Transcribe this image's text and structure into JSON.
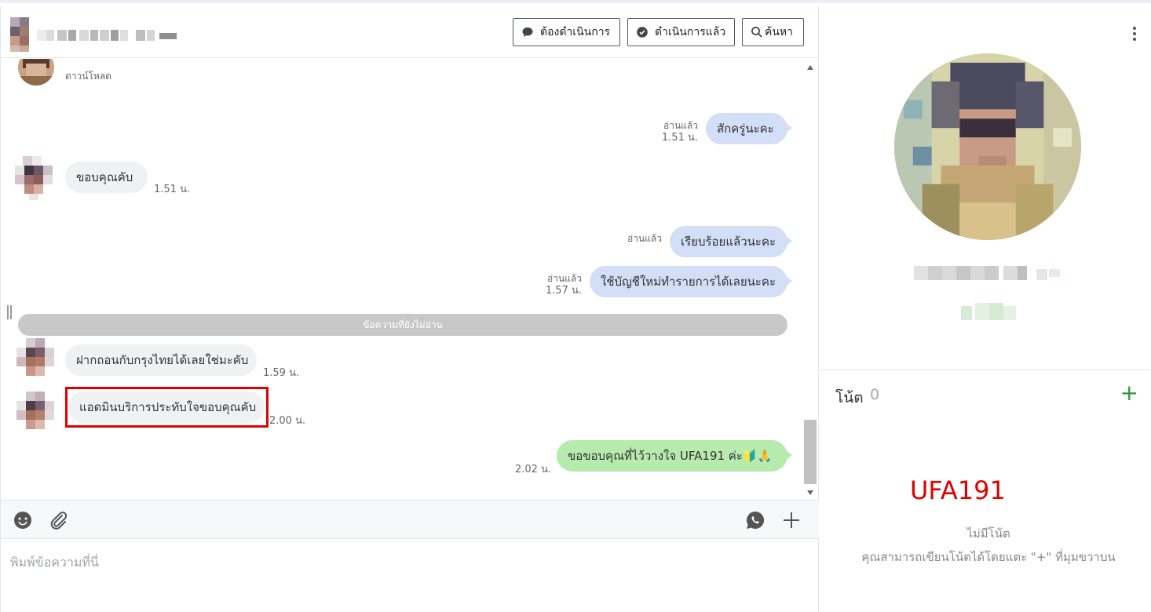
{
  "header": {
    "contact_name_redacted": "",
    "btn_pending": "ต้องดำเนินการ",
    "btn_done": "ดำเนินการแล้ว",
    "btn_search": "ค้นหา"
  },
  "messages": {
    "top_sender_label": "ดาวน์โหลด",
    "items": [
      {
        "side": "out",
        "text": "สักครู่นะคะ",
        "status": "อ่านแล้ว",
        "time": "1.51 น."
      },
      {
        "side": "in",
        "text": "ขอบคุณคับ",
        "time": "1.51 น."
      },
      {
        "side": "out",
        "text": "เรียบร้อยแล้วนะคะ",
        "status": "อ่านแล้ว",
        "time": ""
      },
      {
        "side": "out",
        "text": "ใช้บัญชีใหม่ทำรายการได้เลยนะคะ",
        "status": "อ่านแล้ว",
        "time": "1.57 น."
      },
      {
        "side": "in",
        "text": "ฝากถอนกับกรุงไทยได้เลยใช่มะคับ",
        "time": "1.59 น."
      },
      {
        "side": "in",
        "text": "แอดมินบริการประทับใจขอบคุณคับ",
        "time": "2.00 น."
      },
      {
        "side": "out",
        "text": "ขอขอบคุณที่ไว้วางใจ UFA191 ค่ะ🔰🙏",
        "time": "2.02 น."
      }
    ],
    "unread_divider": "ข้อความที่ยังไม่อ่าน"
  },
  "composer": {
    "placeholder": "พิมพ์ข้อความที่นี่"
  },
  "profile": {
    "notes_title": "โน้ต",
    "notes_count": "0",
    "notes_add": "+",
    "brand_watermark": "UFA191",
    "notes_empty": "ไม่มีโน้ต",
    "notes_hint": "คุณสามารถเขียนโน้ตได้โดยแตะ \"+\" ที่มุมขวาบน"
  },
  "colors": {
    "bubble_out": "#d3def7",
    "bubble_in": "#f0f1f3",
    "bubble_green": "#b6ebad",
    "highlight": "#e00000",
    "accent_green": "#2a9a3c"
  },
  "icons": [
    "chat-bubble-icon",
    "check-circle-icon",
    "search-icon",
    "more-vertical-icon",
    "emoji-icon",
    "paperclip-icon",
    "whatsapp-icon",
    "plus-icon",
    "scroll-up-icon",
    "scroll-down-icon"
  ]
}
